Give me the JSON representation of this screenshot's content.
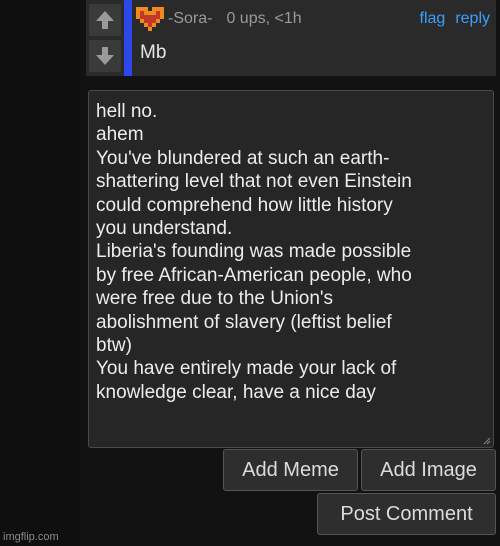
{
  "comment": {
    "username": "-Sora-",
    "meta": "0 ups, <1h",
    "flag_label": "flag",
    "reply_label": "reply",
    "body": "Mb",
    "accent_color": "#2d48e8",
    "link_color": "#3aa0ff",
    "avatar_icon": "pixel-heart-icon",
    "upvote_icon": "arrow-up-icon",
    "downvote_icon": "arrow-down-icon"
  },
  "composer": {
    "text": "hell no.\nahem\nYou've blundered at such an earth-\nshattering level that not even Einstein\ncould comprehend how little history\nyou understand.\nLiberia's founding was made possible\nby free African-American people, who\nwere free due to the Union's\nabolishment of slavery (leftist belief\nbtw)\nYou have entirely made your lack of\nknowledge clear, have a nice day"
  },
  "actions": {
    "add_meme": "Add Meme",
    "add_image": "Add Image",
    "post_comment": "Post Comment"
  },
  "watermark": "imgflip.com"
}
